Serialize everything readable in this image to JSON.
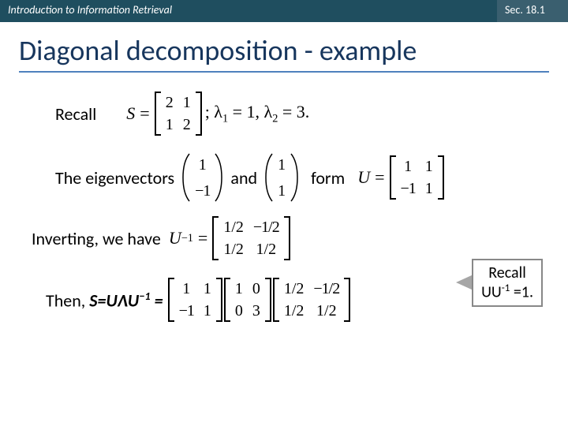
{
  "header": {
    "left": "Introduction to Information Retrieval",
    "right": "Sec. 18.1"
  },
  "title": "Diagonal decomposition - example",
  "recall_label": "Recall",
  "recall_math": {
    "S": "S",
    "matrix": [
      [
        "2",
        "1"
      ],
      [
        "1",
        "2"
      ]
    ],
    "after": "; λ",
    "l1i": "1",
    "l1v": "= 1,",
    "l2": "λ",
    "l2i": "2",
    "l2v": "= 3."
  },
  "eig": {
    "label": "The eigenvectors",
    "v1": [
      "1",
      "−1"
    ],
    "and": "and",
    "v2": [
      "1",
      "1"
    ],
    "form": "form",
    "U": "U",
    "Um": [
      [
        "1",
        "1"
      ],
      [
        "−1",
        "1"
      ]
    ]
  },
  "inv": {
    "label": "Inverting, we have",
    "U": "U",
    "sup": "−1",
    "m": [
      [
        "1/2",
        "−1/2"
      ],
      [
        "1/2",
        "1/2"
      ]
    ]
  },
  "callout": {
    "line1": "Recall",
    "line2_a": "UU",
    "line2_sup": "-1",
    "line2_b": " =1."
  },
  "then": {
    "pre": "Then, ",
    "expr_a": "S=U",
    "lam": "Λ",
    "expr_b": "U",
    "sup": "−1",
    "expr_c": " =",
    "m1": [
      [
        "1",
        "1"
      ],
      [
        "−1",
        "1"
      ]
    ],
    "m2": [
      [
        "1",
        "0"
      ],
      [
        "0",
        "3"
      ]
    ],
    "m3": [
      [
        "1/2",
        "−1/2"
      ],
      [
        "1/2",
        "1/2"
      ]
    ]
  }
}
